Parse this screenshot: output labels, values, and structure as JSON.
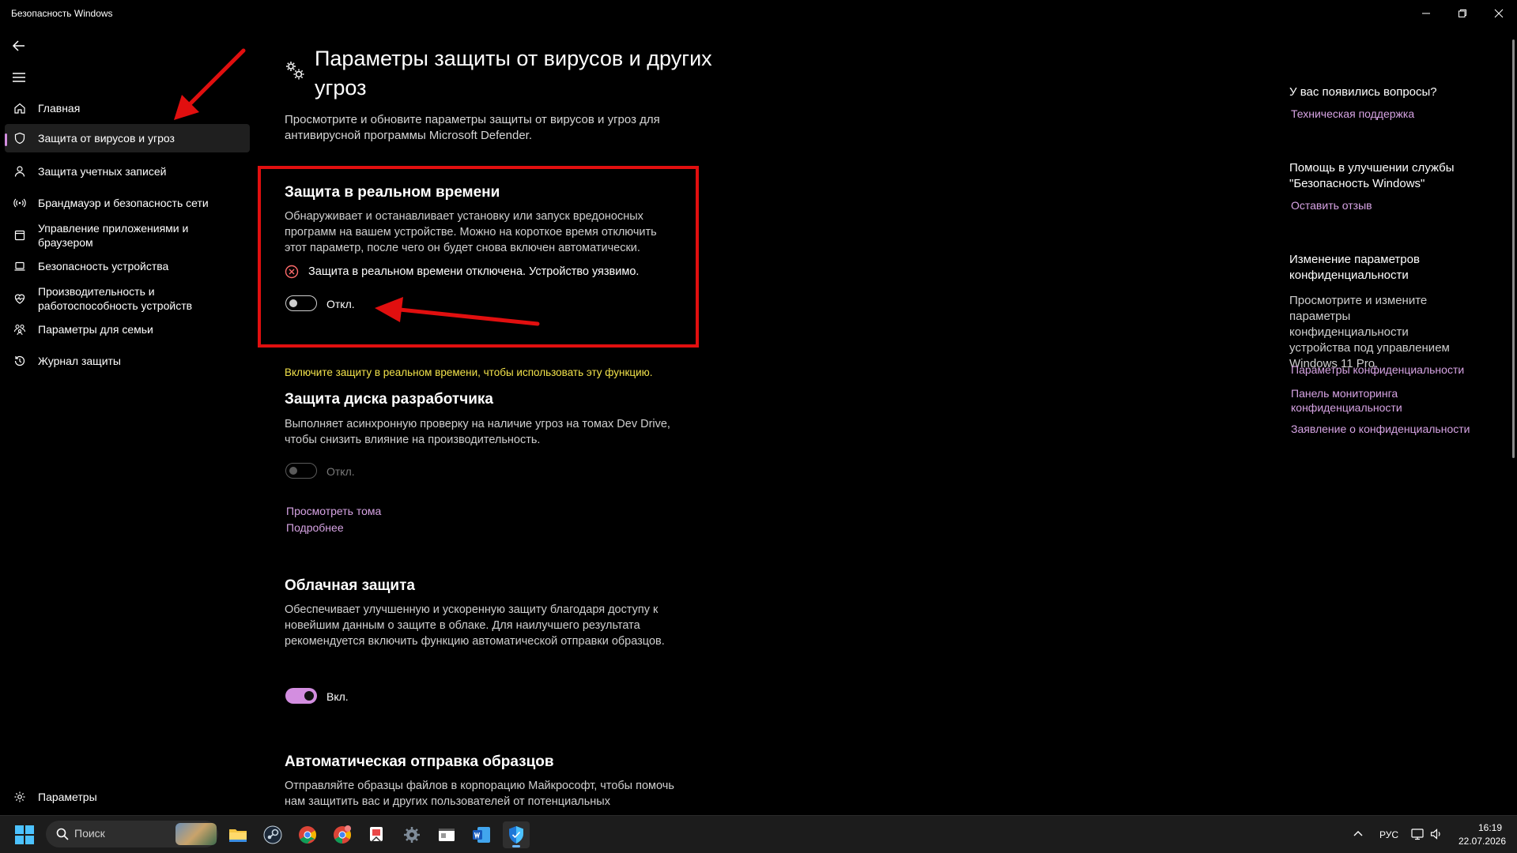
{
  "window": {
    "title": "Безопасность Windows"
  },
  "sidebar": {
    "items": [
      {
        "label": "Главная",
        "icon": "home-icon"
      },
      {
        "label": "Защита от вирусов и угроз",
        "icon": "shield-icon"
      },
      {
        "label": "Защита учетных записей",
        "icon": "person-icon"
      },
      {
        "label": "Брандмауэр и безопасность сети",
        "icon": "antenna-icon"
      },
      {
        "label": "Управление приложениями и браузером",
        "icon": "app-window-icon"
      },
      {
        "label": "Безопасность устройства",
        "icon": "laptop-icon"
      },
      {
        "label": "Производительность и работоспособность устройств",
        "icon": "heart-pulse-icon"
      },
      {
        "label": "Параметры для семьи",
        "icon": "family-icon"
      },
      {
        "label": "Журнал защиты",
        "icon": "history-icon"
      }
    ],
    "settings_label": "Параметры"
  },
  "main": {
    "title": "Параметры защиты от вирусов и других угроз",
    "description": "Просмотрите и обновите параметры защиты от вирусов и угроз для антивирусной программы Microsoft Defender.",
    "realtime": {
      "title": "Защита в реальном времени",
      "description": "Обнаруживает и останавливает установку или запуск вредоносных программ на вашем устройстве. Можно на короткое время отключить этот параметр, после чего он будет снова включен автоматически.",
      "status": "Защита в реальном времени отключена. Устройство уязвимо.",
      "toggle_label": "Откл.",
      "toggle_on": false
    },
    "warning": "Включите защиту в реальном времени, чтобы использовать эту функцию.",
    "devdrive": {
      "title": "Защита диска разработчика",
      "description": "Выполняет асинхронную проверку на наличие угроз на томах Dev Drive, чтобы снизить влияние на производительность.",
      "toggle_label": "Откл.",
      "toggle_on": false,
      "link_volumes": "Просмотреть тома",
      "link_more": "Подробнее"
    },
    "cloud": {
      "title": "Облачная защита",
      "description": "Обеспечивает улучшенную и ускоренную защиту благодаря доступу к новейшим данным о защите в облаке. Для наилучшего результата рекомендуется включить функцию автоматической отправки образцов.",
      "toggle_label": "Вкл.",
      "toggle_on": true
    },
    "samples": {
      "title": "Автоматическая отправка образцов",
      "description": "Отправляйте образцы файлов в корпорацию Майкрософт, чтобы помочь нам защитить вас и других пользователей от потенциальных"
    }
  },
  "right": {
    "questions_title": "У вас появились вопросы?",
    "support_link": "Техническая поддержка",
    "improve_title": "Помощь в улучшении службы \"Безопасность Windows\"",
    "feedback_link": "Оставить отзыв",
    "privacy_title": "Изменение параметров конфиденциальности",
    "privacy_text": "Просмотрите и измените параметры конфиденциальности устройства под управлением Windows 11 Pro.",
    "privacy_links": [
      "Параметры конфиденциальности",
      "Панель мониторинга конфиденциальности",
      "Заявление о конфиденциальности"
    ]
  },
  "taskbar": {
    "search_placeholder": "Поиск",
    "language": "РУС",
    "time": "16:19",
    "date": "22.07.2026",
    "apps": [
      "file-explorer-icon",
      "steam-icon",
      "chrome-icon",
      "chrome-beta-icon",
      "snipping-tool-icon",
      "settings-icon",
      "window-app-icon",
      "word-icon",
      "defender-icon"
    ]
  },
  "colors": {
    "accent": "#d38ee0",
    "highlight": "#e10f0f",
    "warning": "#f1e14a",
    "link": "#d6a3e3"
  }
}
